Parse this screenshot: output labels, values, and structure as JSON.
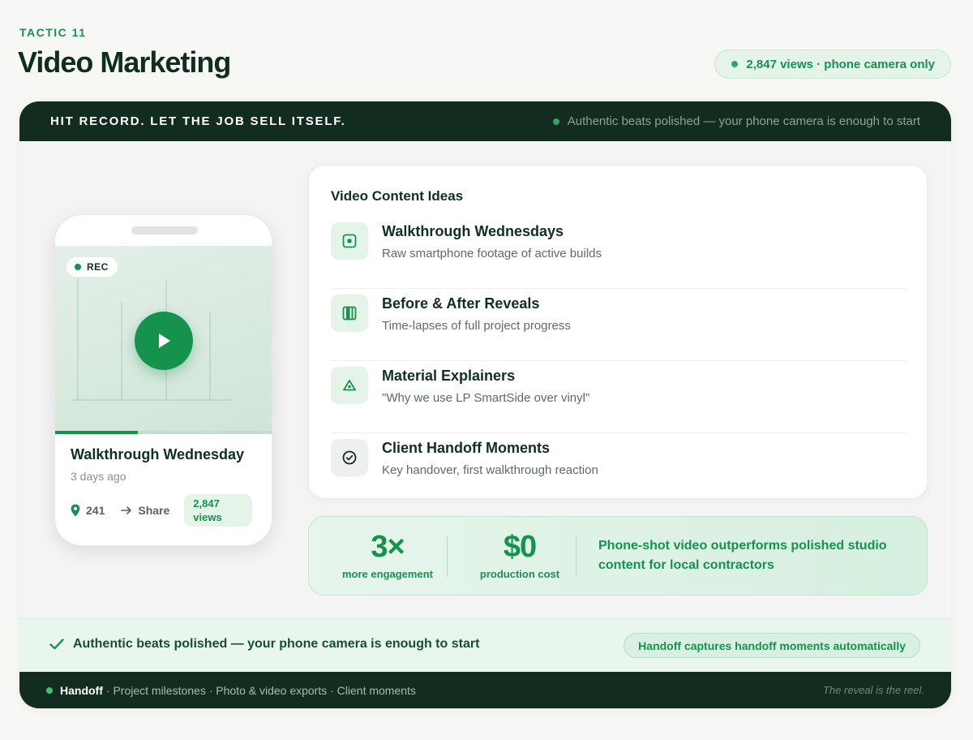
{
  "header": {
    "eyebrow": "TACTIC 11",
    "title": "Video Marketing",
    "views_pill": "2,847 views · phone camera only"
  },
  "card": {
    "slogan": "HIT RECORD. LET THE JOB SELL ITSELF.",
    "tagline": "Authentic beats polished — your phone camera is enough to start"
  },
  "phone": {
    "rec_label": "REC",
    "progress_fraction": 0.38,
    "video_title": "Walkthrough Wednesday",
    "video_age": "3 days ago",
    "likes": "241",
    "share_label": "Share",
    "views_chip": "2,847 views"
  },
  "ideas": {
    "title": "Video Content Ideas",
    "items": [
      {
        "title": "Walkthrough Wednesdays",
        "desc": "Raw smartphone footage of active builds",
        "icon": "record-icon"
      },
      {
        "title": "Before & After Reveals",
        "desc": "Time-lapses of full project progress",
        "icon": "split-compare-icon"
      },
      {
        "title": "Material Explainers",
        "desc": "\"Why we use LP SmartSide over vinyl\"",
        "icon": "triangle-icon"
      },
      {
        "title": "Client Handoff Moments",
        "desc": "Key handover, first walkthrough reaction",
        "icon": "check-circle-icon"
      }
    ]
  },
  "stats": {
    "engagement_value": "3×",
    "engagement_label": "more engagement",
    "cost_value": "$0",
    "cost_label": "production cost",
    "note": "Phone-shot video outperforms polished studio content for local contractors"
  },
  "quote_band": {
    "text": "Authentic beats polished — your phone camera is enough to start",
    "pill": "Handoff captures handoff moments automatically"
  },
  "footer": {
    "brand": "Handoff",
    "items": "· Project milestones · Photo & video exports · Client moments",
    "motto": "The reveal is the reel."
  },
  "colors": {
    "brand_green": "#15934d",
    "dark_green": "#122d1f",
    "mint": "#e4f4e9"
  }
}
